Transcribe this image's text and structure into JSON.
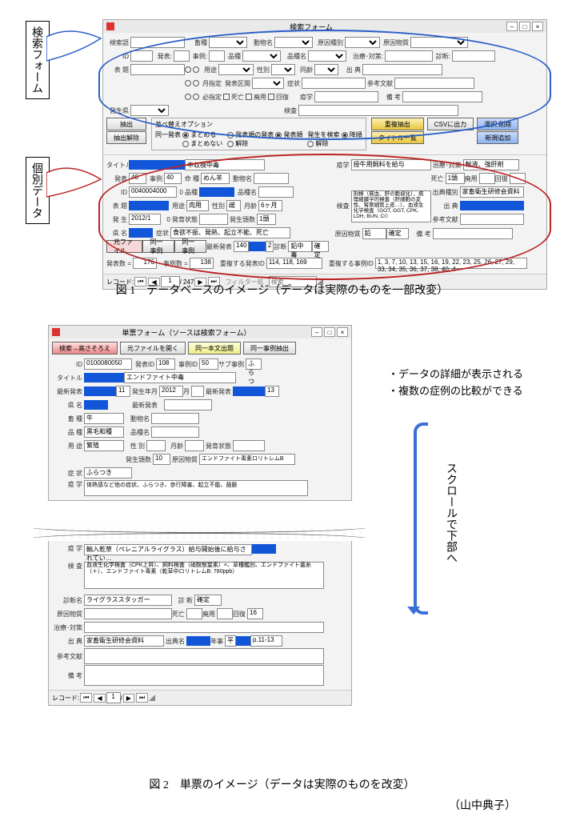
{
  "fig1": {
    "balloon1": "検索フォーム",
    "balloon2": "個別データ",
    "title": "検索フォーム",
    "top": {
      "r1": {
        "kensakugo": "検索語",
        "hinshu": "畜種",
        "doubutsu": "動物名",
        "gensei": "原因種別",
        "genbutsu": "原因物質"
      },
      "r2": {
        "id": "ID",
        "hassei": "発表:",
        "jirei": "事例:",
        "hinshu": "品種",
        "hinshumei": "品種名",
        "chiryo": "治療･対策:",
        "shindan": "診断:"
      },
      "r3": {
        "hyogen": "表 題",
        "yoto": "用途",
        "seibetsu": "性別",
        "zakka": "同齢",
        "shucchi": "出 典"
      },
      "r4": {
        "gekkan": "月指定",
        "hassei_kukan": "発表区間",
        "shojo": "症状",
        "sanko": "参考文献"
      },
      "r5": {
        "hisshi": "必指定",
        "shibo": "死亡",
        "shobun": "廃用",
        "kaifuku": "回復",
        "ekigaku": "疫学",
        "biko": "備 考"
      },
      "r6": {
        "hasseiken": "発生県",
        "kensa": "検査"
      },
      "btn_extract": "抽出",
      "btn_clear": "抽出解除",
      "ops": {
        "legend": "並べ替えオプション",
        "douitsu": "同一発表",
        "matomeru": "まとめる",
        "matomenai": "まとめない",
        "hasseijun": "発表順の発表",
        "hasseijun2": "発表順",
        "kaijo": "解除",
        "hasseikoukou": "発生を検索",
        "kouku": "降順",
        "kaijo2": "解除"
      },
      "btn_r1": "重複抽出",
      "btn_r2": "タイトル一覧",
      "btn_csv": "CSVに出力",
      "btn_del": "選択:削除",
      "btn_new": "新規追加"
    },
    "detail": {
      "titlelbl": "タイトル",
      "midashi": "中収検中毒",
      "r1": {
        "hassei": "発表",
        "v1": "40",
        "jirei": "事例",
        "v2": "40",
        "hinmei": "命 種",
        "v2b": "めん羊",
        "doubutsu": "動物名"
      },
      "r2": {
        "id": "ID",
        "idv": "0040004000",
        "hinshu": "0  品種",
        "hinshumei": "品種名"
      },
      "r3": {
        "hyodai": "表 題",
        "yoto": "用途",
        "yotov": "肉用",
        "seibetsu": "性別",
        "sexv": "雌",
        "gekka": "月齢",
        "mv": "6ヶ月"
      },
      "r4": {
        "hassei2": "発 生",
        "dv": "2012/1",
        "kubun": "0  発育状態",
        "hasseisu": "発生頭数",
        "hn": "1頭"
      },
      "r5": {
        "ken": "県 名",
        "shojo": "症状",
        "sv": "食欲不振、発熱、起立不能、死亡"
      },
      "btn_motofile": "元ファイル",
      "btn_doitsu": "同一事例",
      "btn_doitsujirei": "同一事例",
      "saishin": "最新発表",
      "saishinv": "140",
      "rep": "2",
      "shindan": "診断",
      "shv": "鉛中毒",
      "kakutei": "確定",
      "side": {
        "ekigaku": "疫学",
        "ekv": "授牛用飼料を給与",
        "kensa": "検査",
        "kensav": "剖検（貧血、肝の脆弱化）、病理組織学的検査（肝細胞の変性、腎尿細管上皮…）、血液生化学検査（GOT, GGT, CPK, LDH, BUN, Cr）",
        "genbutsu": "原因物質",
        "gv": "鉛",
        "kakutei": "確定",
        "biko": "備 考",
        "chiryo": "治療･対策",
        "chv": "輸液、強肝剤",
        "shibou": "死亡",
        "sn": "1頭",
        "shobun": "廃用",
        "kaifuku": "回復",
        "shucchi": "出典種別",
        "shv": "家畜衛生研修会資料",
        "shucchi2": "出 典",
        "sanko": "参考文献"
      },
      "hasseisu_lbl": "発表数 =",
      "hasseisu_v": "176",
      "jireisu_lbl": "事例数 =",
      "jireisu_v": "138",
      "chofuku1": "重複する発表ID",
      "chv1": "114, 118, 169",
      "chofuku2": "重複する事例ID",
      "chv2": "1, 3, 7, 10, 13, 15, 16, 19, 22, 23, 25, 26, 27, 29, 33, 34, 35, 36, 37, 38, 40, 4",
      "nav": {
        "rec": "レコード: ",
        "pos": "1",
        "total": "/ 247",
        "filter": "フィルター処",
        "search": "検索"
      }
    },
    "caption": "図 1　データベースのイメージ（データは実際のものを一部改変）"
  },
  "fig2": {
    "title": "単票フォーム（ソースは検索フォーム）",
    "toolbar": {
      "b1": "検索→高さそろえ",
      "b2": "元ファイルを開く",
      "b3": "同一本文出題",
      "b4": "同一事例抽出"
    },
    "top": {
      "id": "ID",
      "idv": "0100080050",
      "hassei": "発表ID",
      "hv": "108",
      "jirei": "事例ID",
      "jv": "50",
      "sub": "サブ事例",
      "sv": "ふらつき",
      "title": "タイトル",
      "tailv": "エンドファイト中毒",
      "saishin": "最新発表",
      "num": "11",
      "hasseinen": "発生年月",
      "y": "2012",
      "gekka": "月",
      "saishin2": "最新発表",
      "sn2": "13",
      "kenmei": "県 名",
      "sai": "最新発表",
      "chiku": "畜 種",
      "cv": "牛",
      "doubutsu": "動物名",
      "hinshu": "品 種",
      "hv2": "黒毛和種",
      "hinshumei": "品種名",
      "yoto": "用 途",
      "yv": "繁殖",
      "sei": "性 別",
      "gekka2": "月齢",
      "hassei_n": "発育状態",
      "hasseisu": "発生頭数",
      "hn": "10",
      "shv": "エンドファイト毒素ロリトレムB",
      "shojo": "症 状",
      "ekigaku": "疫 学",
      "ev": "体熱感など他の症状、ふらつき、歩行障害、起立不能、鼓脹"
    },
    "mid": {
      "ekigaku": "疫 学",
      "ev": "輸入乾草（ペレニアルライグラス）給与開始後に給与されてい…",
      "kensa": "検 査",
      "kv": "血液生化学検査（CPK上昇）、飼料検査（硝酸態窒素）×、草種鑑別、エンドファイト菌糸（＋）、エンドファイト毒素（乾草中ロリトレムB: 780ppb）",
      "shindan": "診断名",
      "shv": "ライグラススタッガー",
      "kubun": "診 断",
      "kv2": "確定",
      "genbutsu": "原因物質",
      "shibou": "死亡",
      "haiyo": "廃用",
      "kaifuku": "回復",
      "kn": "16",
      "chiryo": "治療･対策",
      "shucchi": "出 典",
      "sv": "家畜衛生研修会資料",
      "shusai": "出典名",
      "nen": "年事",
      "nv": "平",
      "pg": "p.11-13",
      "sanko": "参考文献",
      "biko": "備 考"
    },
    "notes": {
      "l1": "・データの詳細が表示される",
      "l2": "・複数の症例の比較ができる"
    },
    "scroll_label": "スクロールで下部へ",
    "nav": {
      "rec": "レコード:",
      "pos": "1",
      "total": "/"
    },
    "caption": "図 2　単票のイメージ（データは実際のものを改変）",
    "author": "（山中典子）"
  }
}
